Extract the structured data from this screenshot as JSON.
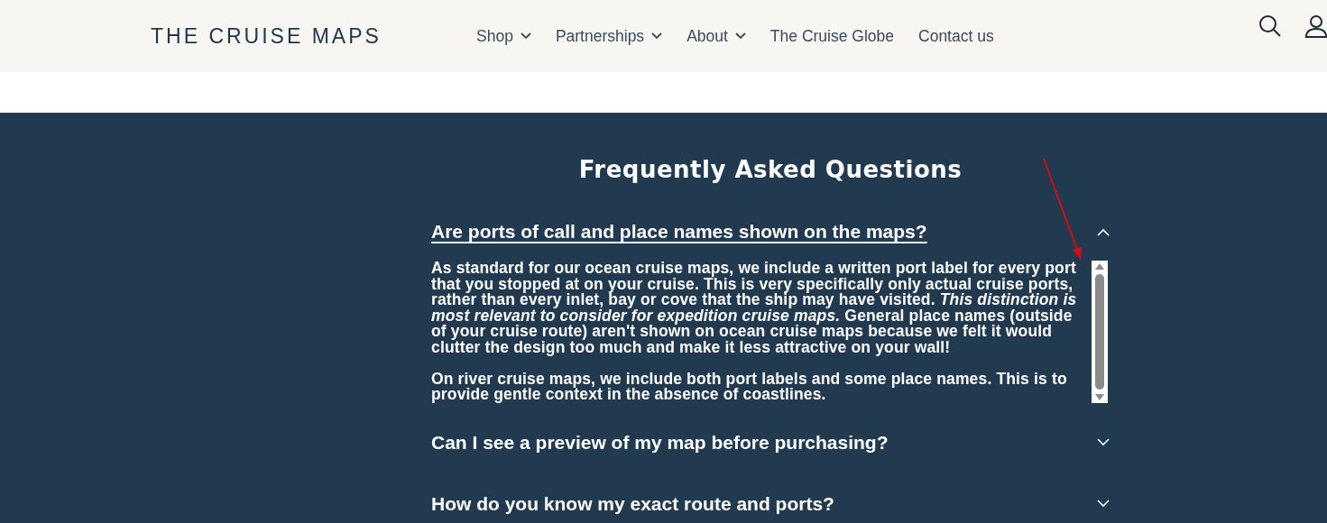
{
  "header": {
    "logo": "THE CRUISE MAPS",
    "nav": [
      {
        "label": "Shop",
        "has_menu": true
      },
      {
        "label": "Partnerships",
        "has_menu": true
      },
      {
        "label": "About",
        "has_menu": true
      },
      {
        "label": "The Cruise Globe",
        "has_menu": false
      },
      {
        "label": "Contact us",
        "has_menu": false
      }
    ]
  },
  "faq": {
    "title": "Frequently Asked Questions",
    "items": [
      {
        "question": "Are ports of call and place names shown on the maps?",
        "expanded": true,
        "answer": [
          "As standard for our ocean cruise maps, we include a written port label for every **port** that you stopped at on your cruise. This is very specifically only actual cruise ports, rather than every inlet, bay or cove that the ship may have visited. *This distinction is most relevant to consider for expedition cruise maps.* General place names (outside of your cruise route) aren't shown on ocean cruise maps because we felt it would clutter the design too much and make it less attractive on your wall!",
          "On river cruise maps, we include both port labels and some place names. This is to provide gentle context in the absence of coastlines."
        ]
      },
      {
        "question": "Can I see a preview of my map before purchasing?",
        "expanded": false
      },
      {
        "question": "How do you know my exact route and ports?",
        "expanded": false
      }
    ]
  }
}
